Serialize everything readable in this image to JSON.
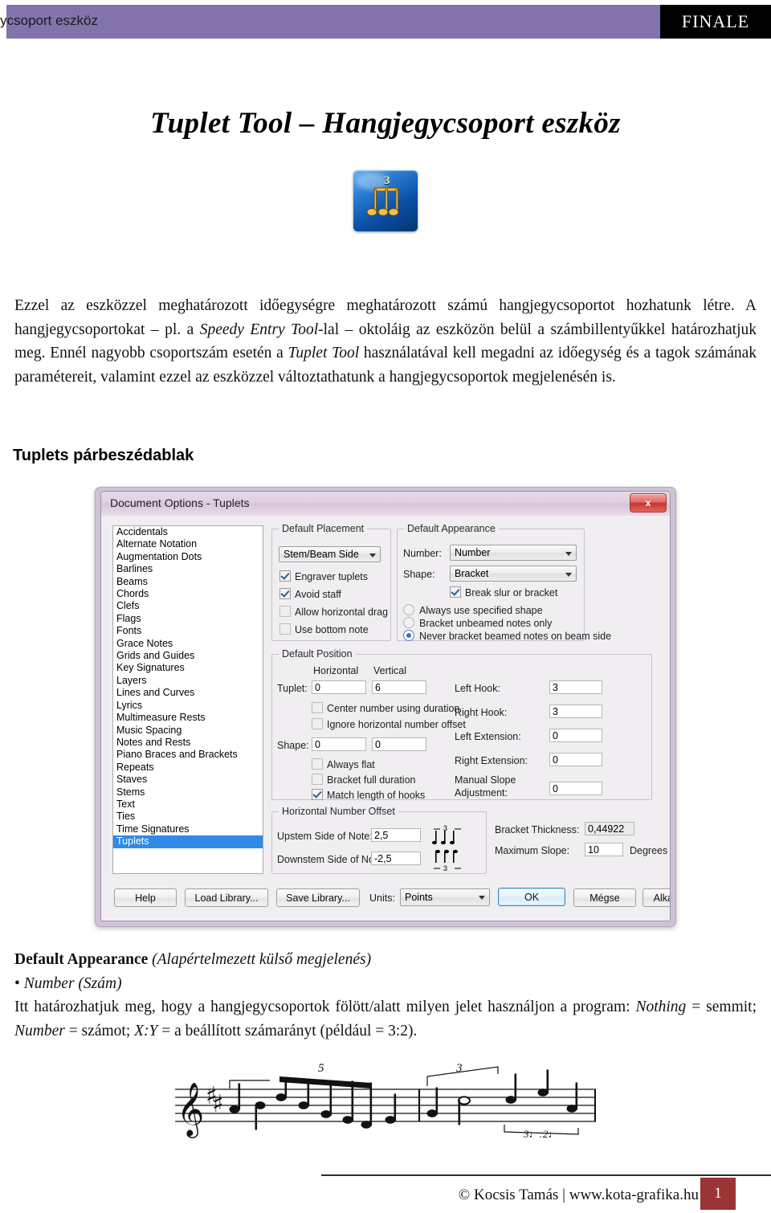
{
  "header": {
    "running_title": "Tuplet Tool – Hangjegycsoport eszköz",
    "brand": "FINALE",
    "band_color": "#8273ad"
  },
  "page_title": "Tuplet Tool – Hangjegycsoport eszköz",
  "tool_icon": {
    "number": "3",
    "name": "tuplet-tool-icon"
  },
  "intro_paragraph_html": "Ezzel az eszközzel meghatározott időegységre meghatározott számú hangjegycsoportot hozhatunk létre. A hangjegycsoportokat – pl. a <i>Speedy Entry Tool</i>-lal – oktoláig az eszközön belül a számbillentyűkkel határozhatjuk meg. Ennél nagyobb csoportszám esetén a <i>Tuplet Tool</i> használatával kell megadni az időegység és a tagok számának paramétereit, valamint ezzel az eszközzel változtathatunk a hangjegycsoportok megjelenésén is.",
  "dialog_section_heading": "Tuplets párbeszédablak",
  "dialog": {
    "title": "Document Options - Tuplets",
    "close_label": "x",
    "category_list": [
      "Accidentals",
      "Alternate Notation",
      "Augmentation Dots",
      "Barlines",
      "Beams",
      "Chords",
      "Clefs",
      "Flags",
      "Fonts",
      "Grace Notes",
      "Grids and Guides",
      "Key Signatures",
      "Layers",
      "Lines and Curves",
      "Lyrics",
      "Multimeasure Rests",
      "Music Spacing",
      "Notes and Rests",
      "Piano Braces and Brackets",
      "Repeats",
      "Staves",
      "Stems",
      "Text",
      "Ties",
      "Time Signatures",
      "Tuplets"
    ],
    "selected_category": "Tuplets",
    "default_placement": {
      "legend": "Default Placement",
      "combo_value": "Stem/Beam Side",
      "checkboxes": [
        {
          "label": "Engraver tuplets",
          "checked": true
        },
        {
          "label": "Avoid staff",
          "checked": true
        },
        {
          "label": "Allow horizontal drag",
          "checked": false
        },
        {
          "label": "Use bottom note",
          "checked": false
        }
      ]
    },
    "default_appearance": {
      "legend": "Default Appearance",
      "number_label": "Number:",
      "number_value": "Number",
      "shape_label": "Shape:",
      "shape_value": "Bracket",
      "break_slur": {
        "label": "Break slur or bracket",
        "checked": true
      },
      "radios": [
        {
          "label": "Always use specified shape",
          "selected": false
        },
        {
          "label": "Bracket unbeamed notes only",
          "selected": false
        },
        {
          "label": "Never bracket beamed notes on beam side",
          "selected": true
        }
      ]
    },
    "default_position": {
      "legend": "Default Position",
      "col_horizontal": "Horizontal",
      "col_vertical": "Vertical",
      "tuplet_label": "Tuplet:",
      "tuplet_h": "0",
      "tuplet_v": "6",
      "center_number": {
        "label": "Center number using duration",
        "checked": false
      },
      "ignore_offset": {
        "label": "Ignore horizontal number offset",
        "checked": false
      },
      "shape_label": "Shape:",
      "shape_h": "0",
      "shape_v": "0",
      "always_flat": {
        "label": "Always flat",
        "checked": false
      },
      "bracket_full": {
        "label": "Bracket full duration",
        "checked": false
      },
      "match_hooks": {
        "label": "Match length of hooks",
        "checked": true
      },
      "left_hook_label": "Left Hook:",
      "left_hook": "3",
      "right_hook_label": "Right Hook:",
      "right_hook": "3",
      "left_ext_label": "Left Extension:",
      "left_ext": "0",
      "right_ext_label": "Right Extension:",
      "right_ext": "0",
      "manual_slope_label_1": "Manual Slope",
      "manual_slope_label_2": "Adjustment:",
      "manual_slope": "0"
    },
    "horizontal_number_offset": {
      "legend": "Horizontal Number Offset",
      "upstem_label": "Upstem Side of Note:",
      "upstem_value": "2,5",
      "downstem_label": "Downstem Side of Note:",
      "downstem_value": "-2,5"
    },
    "bracket": {
      "thickness_label": "Bracket Thickness:",
      "thickness_value": "0,44922",
      "max_slope_label": "Maximum Slope:",
      "max_slope_value": "10",
      "degrees_label": "Degrees"
    },
    "buttons": {
      "help": "Help",
      "load_library": "Load Library...",
      "save_library": "Save Library...",
      "units_label": "Units:",
      "units_value": "Points",
      "ok": "OK",
      "cancel": "Mégse",
      "apply": "Alkalmaz"
    }
  },
  "appearance_section_html": "<span class=\"b\">Default Appearance</span> <i>(Alapértelmezett külső megjelenés)</i><br>• <i>Number (Szám)</i><br>Itt határozhatjuk meg, hogy a hangjegycsoportok fölött/alatt milyen jelet használjon a program: <i>Nothing</i> = semmit; <i>Number</i> = számot; <i>X:Y</i> = a beállított számarányt (például = 3:2).",
  "music_example": {
    "clef": "treble",
    "key_sharps": 2,
    "tuplet_labels": [
      "5",
      "3",
      "3♩:2♩"
    ]
  },
  "footer": {
    "copyright": "© Kocsis Tamás | www.kota-grafika.hu",
    "page_number": "1",
    "page_box_color": "#9c3334"
  }
}
